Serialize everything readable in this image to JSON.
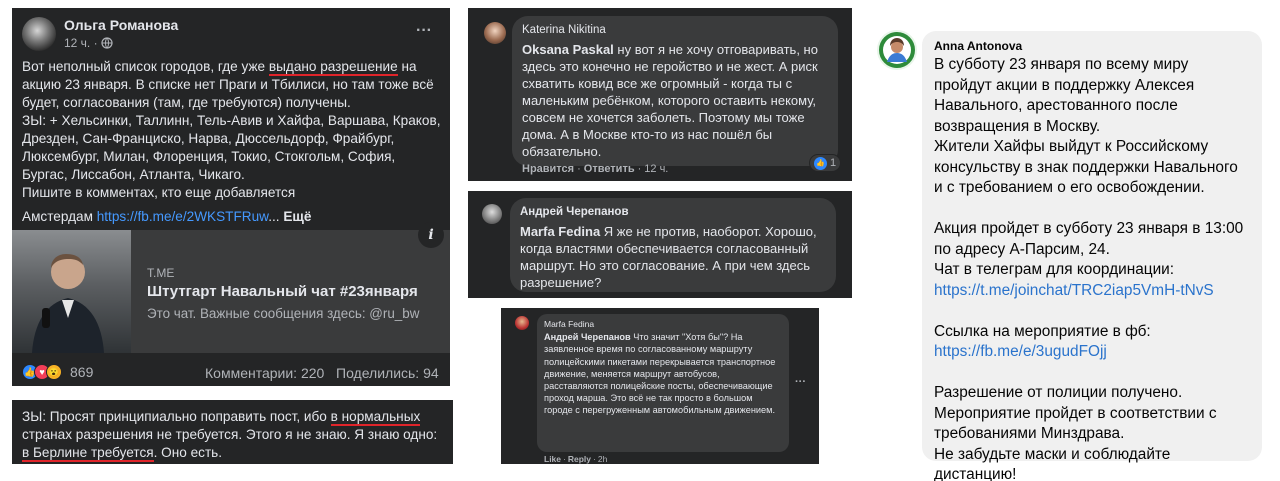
{
  "post": {
    "author": "Ольга Романова",
    "meta": "12 ч. ·",
    "more": "···",
    "text_1": "Вот неполный список городов, где уже ",
    "text_highlight": "выдано разрешение",
    "text_2": " на акцию 23 января. В списке нет Праги и Тбилиси, но там тоже всё будет, согласования (там, где требуются) получены.",
    "text_3": "ЗЫ: + Хельсинки, Таллинн, Тель-Авив и Хайфа, Варшава, Краков, Дрезден, Сан-Франциско, Нарва, Дюссельдорф, Фрайбург, Люксембург, Милан, Флоренция, Токио, Стокгольм, София, Бургас, Лиссабон, Атланта, Чикаго.",
    "text_4": "Пишите в комментах, кто еще добавляется",
    "text_5": "Амстердам ",
    "link": "https://fb.me/e/2WKSTFRuw",
    "ellipsis": "...",
    "more_label": "Ещё",
    "card": {
      "domain": "T.ME",
      "title": "Штутгарт Навальный чат #23января",
      "desc": "Это чат. Важные сообщения здесь: @ru_bw",
      "info": "i"
    },
    "reactions_count": "869",
    "comments": "Комментарии: 220",
    "shares": "Поделились: 94"
  },
  "ps": {
    "text_1": "ЗЫ: Просят принципиально поправить пост, ибо ",
    "highlight_1": "в нормальных",
    "text_2": " странах разрешения не требуется. Этого я не знаю. Я знаю одно: ",
    "highlight_2": "в Берлине требуется",
    "text_3": ". Оно есть."
  },
  "comment1": {
    "author": "Katerina Nikitina",
    "mention": "Oksana Paskal",
    "text": " ну вот я не хочу отговаривать, но здесь это конечно не геройство и не жест. А риск схватить ковид все же огромный - когда ты с маленьким ребёнком, которого оставить некому, совсем не хочется заболеть. Поэтому мы тоже дома. А в Москве кто-то из нас пошёл бы обязательно.",
    "like": "Нравится",
    "reply": "Ответить",
    "time": "12 ч.",
    "like_count": "1"
  },
  "comment2": {
    "author": "Андрей Черепанов",
    "mention": "Marfa Fedina",
    "text": " Я же не против, наоборот. Хорошо, когда властями обеспечивается согласованный маршрут. Но это согласование. А при чем здесь разрешение?"
  },
  "comment3": {
    "author": "Marfa Fedina",
    "mention": "Андрей Черепанов",
    "text": " Что значит \"Хотя бы\"? На заявленное время по согласованному маршруту полицейскими пикетами перекрывается транспортное движение, меняется маршрут автобусов, расставляются полицейские посты, обеспечивающие проход марша. Это всё не так просто в большом городе с перегруженным автомобильным движением.",
    "like": "Like",
    "reply": "Reply",
    "time": "2h",
    "more": "···"
  },
  "message": {
    "author": "Anna Antonova",
    "p1": "В субботу 23 января по всему миру пройдут акции в поддержку Алексея Навального, арестованного после возвращения в Москву.",
    "p2": "Жители Хайфы выйдут к Российскому консульству в знак поддержки Навального и с требованием о его освобождении.",
    "p3": "Акция пройдет в субботу 23 января в 13:00 по адресу А-Парсим, 24.",
    "p4": "Чат в телеграм для координации:",
    "link1": "https://t.me/joinchat/TRC2iap5VmH-tNvS",
    "p5": "Ссылка на мероприятие в фб:",
    "link2": "https://fb.me/e/3ugudFOjj",
    "p6": "Разрешение от полиции получено.",
    "p7": "Мероприятие пройдет в соответствии с требованиями Минздрава.",
    "p8": "Не забудьте маски и соблюдайте дистанцию!"
  },
  "colors": {
    "fb_dark": "#242526",
    "bubble": "#3a3b3c",
    "link": "#4599ff",
    "highlight": "#e0242a",
    "msg_bubble": "#f0f0f0",
    "msg_link": "#2a73cc"
  }
}
